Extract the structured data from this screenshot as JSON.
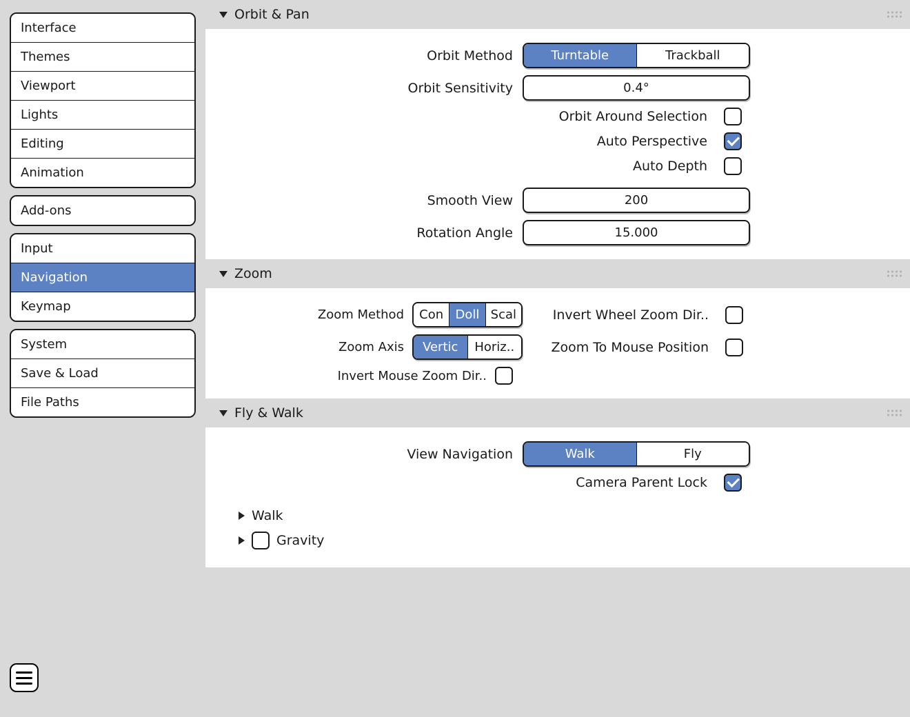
{
  "sidebar": {
    "groups": [
      {
        "items": [
          "Interface",
          "Themes",
          "Viewport",
          "Lights",
          "Editing",
          "Animation"
        ]
      },
      {
        "items": [
          "Add-ons"
        ]
      },
      {
        "items": [
          "Input",
          "Navigation",
          "Keymap"
        ],
        "active_index": 1
      },
      {
        "items": [
          "System",
          "Save & Load",
          "File Paths"
        ]
      }
    ]
  },
  "sections": {
    "orbit": {
      "title": "Orbit & Pan",
      "orbit_method_label": "Orbit Method",
      "orbit_method_options": [
        "Turntable",
        "Trackball"
      ],
      "orbit_method_active": 0,
      "sensitivity_label": "Orbit Sensitivity",
      "sensitivity_value": "0.4°",
      "orbit_around_label": "Orbit Around Selection",
      "orbit_around_checked": false,
      "auto_persp_label": "Auto Perspective",
      "auto_persp_checked": true,
      "auto_depth_label": "Auto Depth",
      "auto_depth_checked": false,
      "smooth_label": "Smooth View",
      "smooth_value": "200",
      "rotation_label": "Rotation Angle",
      "rotation_value": "15.000"
    },
    "zoom": {
      "title": "Zoom",
      "method_label": "Zoom Method",
      "method_options": [
        "Con",
        "Doll",
        "Scal"
      ],
      "method_active": 1,
      "axis_label": "Zoom Axis",
      "axis_options": [
        "Vertic",
        "Horiz.."
      ],
      "axis_active": 0,
      "invert_mouse_label": "Invert Mouse Zoom Dir..",
      "invert_mouse_checked": false,
      "invert_wheel_label": "Invert Wheel Zoom Dir..",
      "invert_wheel_checked": false,
      "to_mouse_label": "Zoom To Mouse Position",
      "to_mouse_checked": false
    },
    "fly": {
      "title": "Fly & Walk",
      "viewnav_label": "View Navigation",
      "viewnav_options": [
        "Walk",
        "Fly"
      ],
      "viewnav_active": 0,
      "camlock_label": "Camera Parent Lock",
      "camlock_checked": true,
      "walk_title": "Walk",
      "gravity_title": "Gravity",
      "gravity_checked": false
    }
  }
}
